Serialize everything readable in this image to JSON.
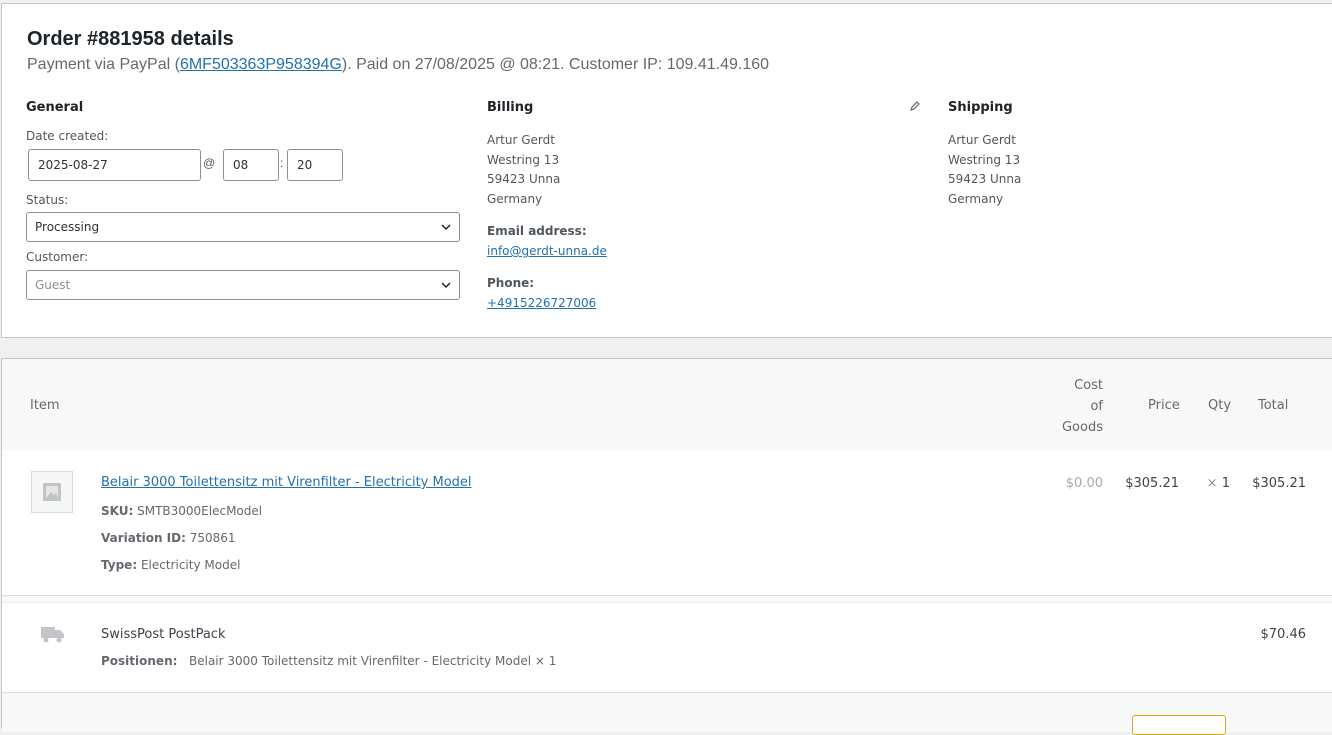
{
  "order": {
    "title": "Order #881958 details",
    "payment_prefix": "Payment via PayPal (",
    "transaction_id": "6MF503363P958394G",
    "payment_suffix": "). Paid on 27/08/2025 @ 08:21. Customer IP: 109.41.49.160"
  },
  "general": {
    "heading": "General",
    "date_label": "Date created:",
    "date_value": "2025-08-27",
    "at_sep": "@",
    "hour_value": "08",
    "colon_sep": ":",
    "minute_value": "20",
    "status_label": "Status:",
    "status_value": "Processing",
    "customer_label": "Customer:",
    "customer_placeholder": "Guest"
  },
  "billing": {
    "heading": "Billing",
    "address": [
      "Artur Gerdt",
      "Westring 13",
      "59423 Unna",
      "Germany"
    ],
    "email_label": "Email address:",
    "email": "info@gerdt-unna.de",
    "phone_label": "Phone:",
    "phone": "+4915226727006"
  },
  "shipping": {
    "heading": "Shipping",
    "address": [
      "Artur Gerdt",
      "Westring 13",
      "59423 Unna",
      "Germany"
    ]
  },
  "items": {
    "headers": {
      "item": "Item",
      "cost_of_goods": [
        "Cost",
        "of",
        "Goods"
      ],
      "price": "Price",
      "qty": "Qty",
      "total": "Total"
    },
    "product": {
      "name": "Belair 3000 Toilettensitz mit Virenfilter - Electricity Model",
      "sku_label": "SKU:",
      "sku": "SMTB3000ElecModel",
      "variation_label": "Variation ID:",
      "variation_id": "750861",
      "type_label": "Type:",
      "type": "Electricity Model",
      "cost": "$0.00",
      "price": "$305.21",
      "qty_symbol": "×",
      "qty": "1",
      "total": "$305.21"
    },
    "shipping_line": {
      "method": "SwissPost PostPack",
      "positions_label": "Positionen:",
      "positions": "Belair 3000 Toilettensitz mit Virenfilter - Electricity Model × 1",
      "total": "$70.46"
    }
  },
  "icons": {
    "edit": "pencil-icon",
    "chevron": "chevron-down-icon",
    "placeholder": "image-placeholder-icon",
    "shipping": "truck-icon"
  },
  "colors": {
    "link": "#2271b1",
    "border": "#c3c4c7",
    "accent_button_border": "#dba617"
  }
}
